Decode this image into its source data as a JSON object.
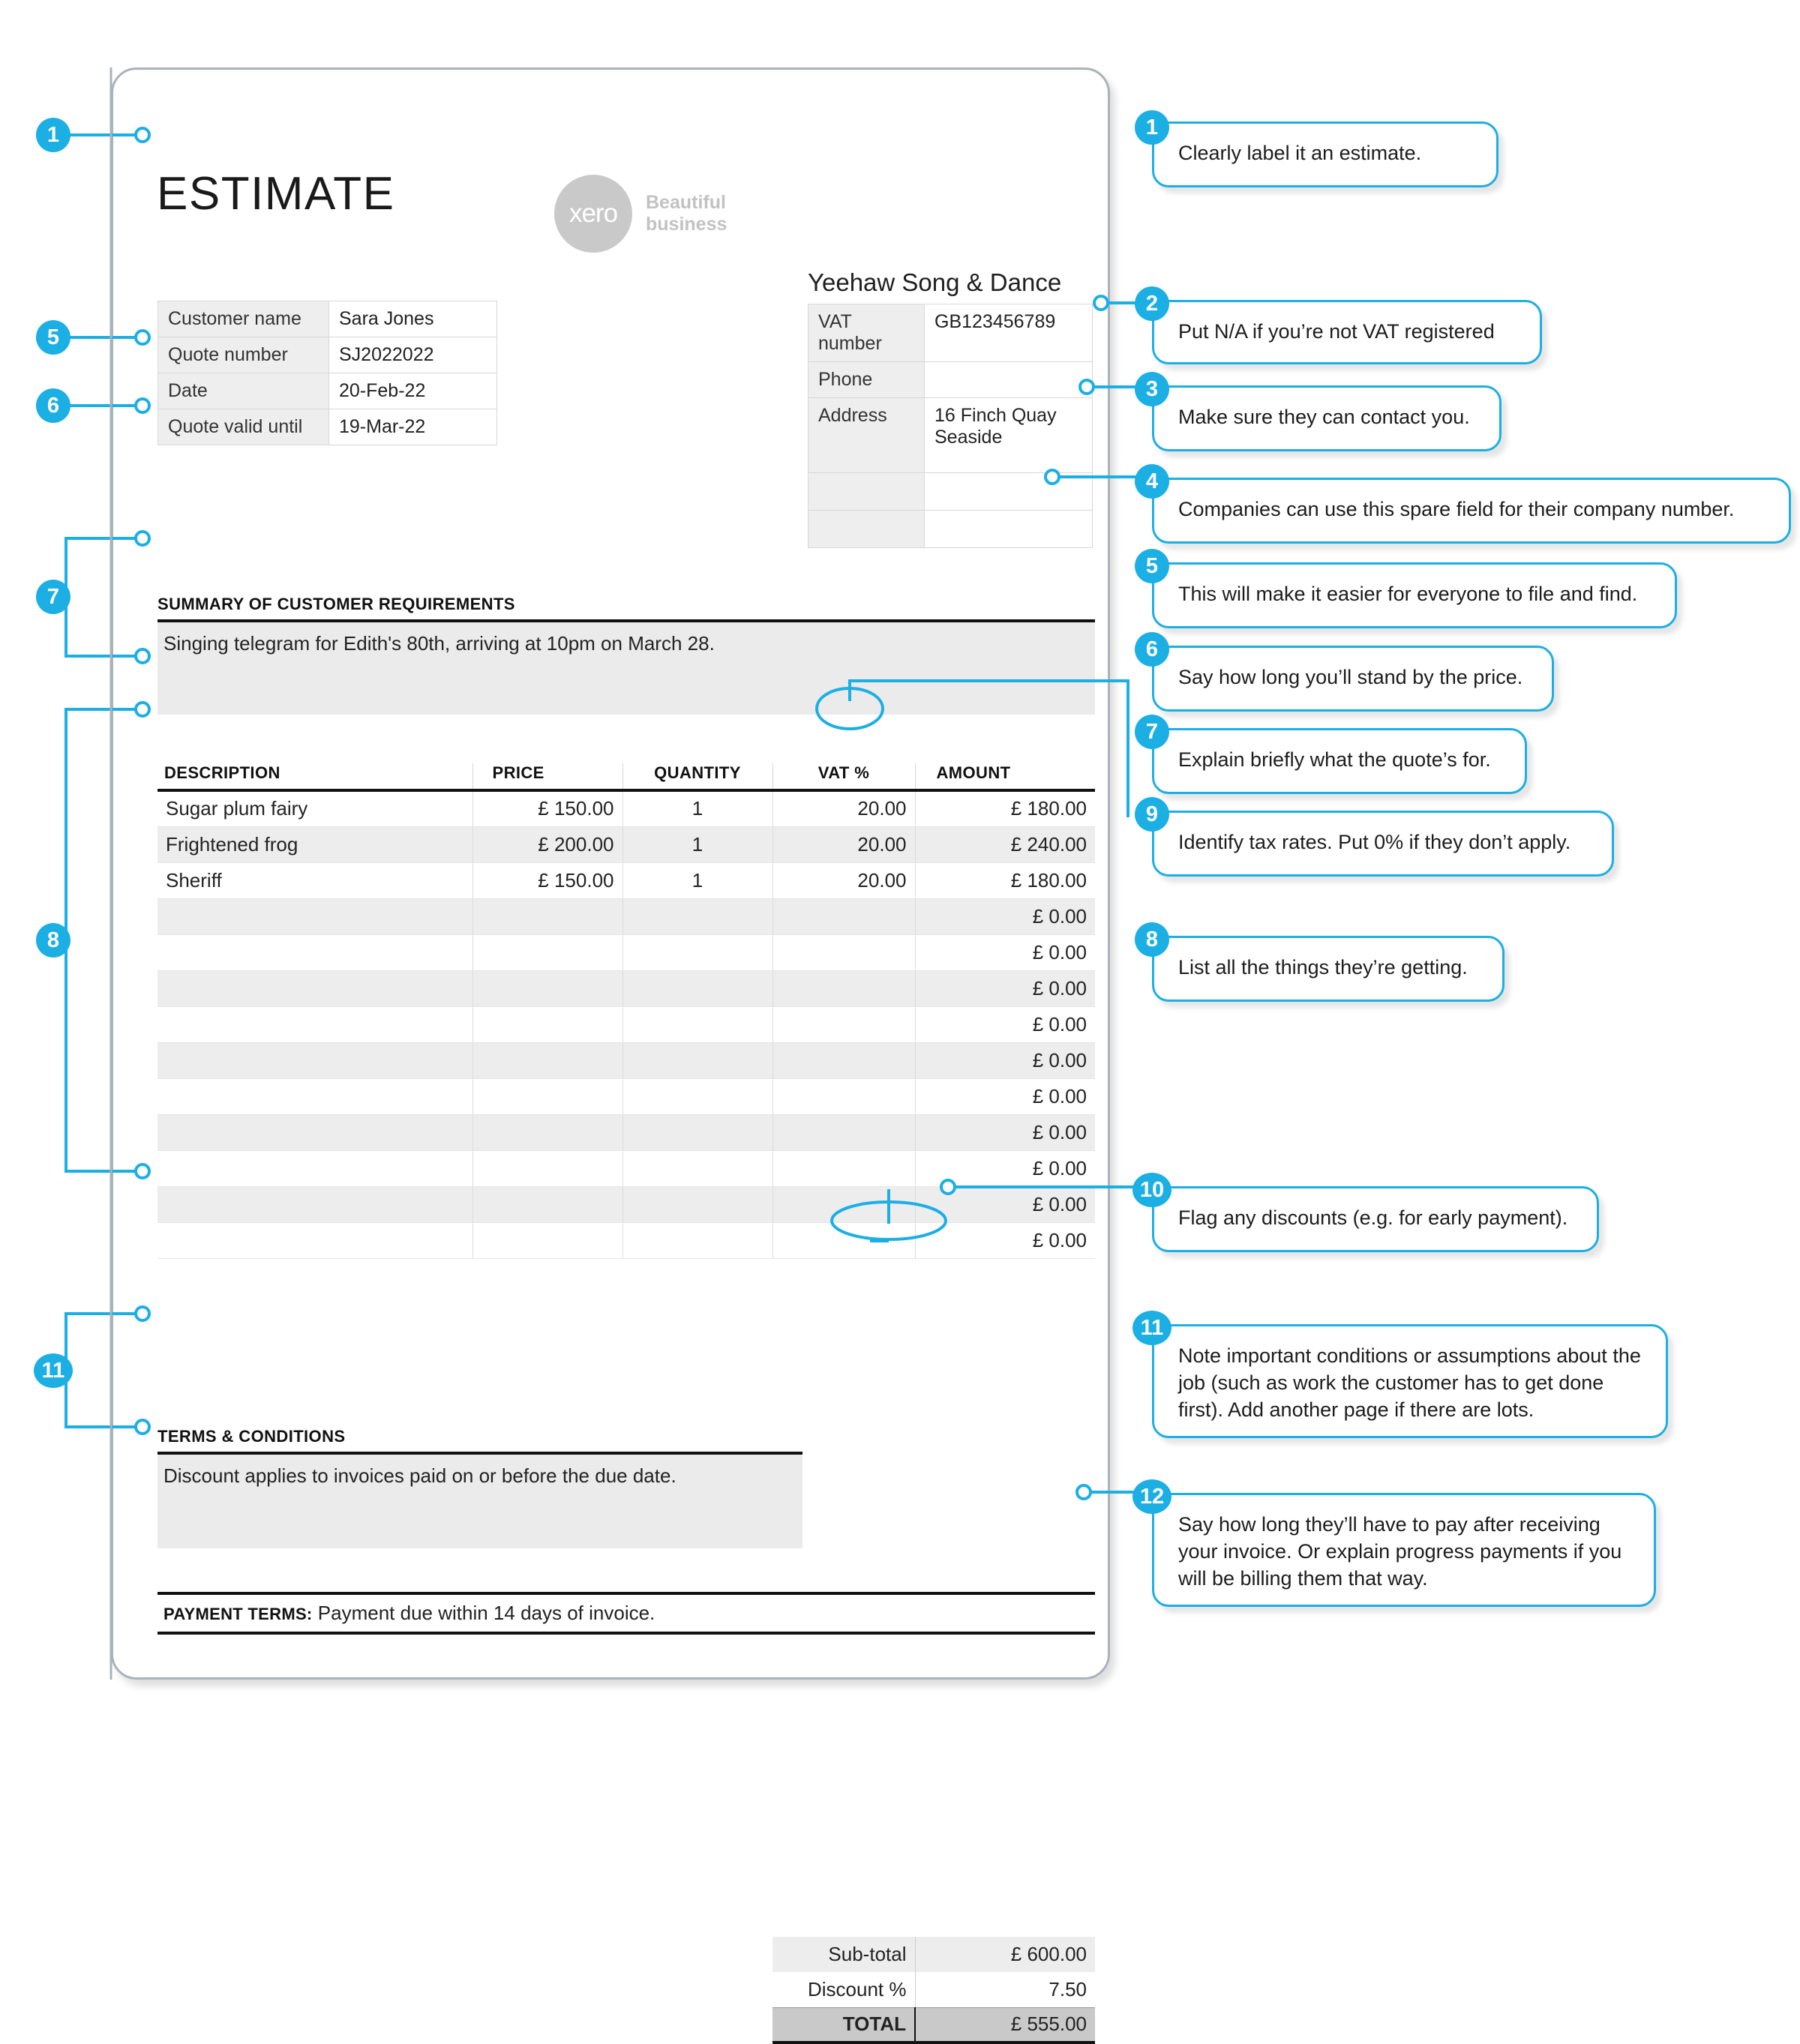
{
  "document": {
    "title": "ESTIMATE",
    "logo": {
      "wordmark": "xero",
      "tagline_line1": "Beautiful",
      "tagline_line2": "business"
    },
    "customer_fields": [
      {
        "label": "Customer name",
        "value": "Sara Jones"
      },
      {
        "label": "Quote number",
        "value": "SJ2022022"
      },
      {
        "label": "Date",
        "value": "20-Feb-22"
      },
      {
        "label": "Quote valid until",
        "value": "19-Mar-22"
      }
    ],
    "company": {
      "name": "Yeehaw Song & Dance",
      "fields": [
        {
          "label": "VAT number",
          "value": "GB123456789"
        },
        {
          "label": "Phone",
          "value": ""
        },
        {
          "label": "Address",
          "value": "16 Finch Quay\nSeaside"
        },
        {
          "label": "",
          "value": ""
        },
        {
          "label": "",
          "value": ""
        }
      ]
    },
    "summary": {
      "heading": "SUMMARY OF CUSTOMER REQUIREMENTS",
      "text": "Singing telegram for Edith's 80th, arriving at 10pm on March 28."
    },
    "items": {
      "columns": [
        "DESCRIPTION",
        "PRICE",
        "QUANTITY",
        "VAT %",
        "AMOUNT"
      ],
      "rows": [
        {
          "description": "Sugar plum fairy",
          "price": "£ 150.00",
          "quantity": "1",
          "vat": "20.00",
          "amount": "£ 180.00"
        },
        {
          "description": "Frightened frog",
          "price": "£ 200.00",
          "quantity": "1",
          "vat": "20.00",
          "amount": "£ 240.00"
        },
        {
          "description": "Sheriff",
          "price": "£ 150.00",
          "quantity": "1",
          "vat": "20.00",
          "amount": "£ 180.00"
        },
        {
          "description": "",
          "price": "",
          "quantity": "",
          "vat": "",
          "amount": "£ 0.00"
        },
        {
          "description": "",
          "price": "",
          "quantity": "",
          "vat": "",
          "amount": "£ 0.00"
        },
        {
          "description": "",
          "price": "",
          "quantity": "",
          "vat": "",
          "amount": "£ 0.00"
        },
        {
          "description": "",
          "price": "",
          "quantity": "",
          "vat": "",
          "amount": "£ 0.00"
        },
        {
          "description": "",
          "price": "",
          "quantity": "",
          "vat": "",
          "amount": "£ 0.00"
        },
        {
          "description": "",
          "price": "",
          "quantity": "",
          "vat": "",
          "amount": "£ 0.00"
        },
        {
          "description": "",
          "price": "",
          "quantity": "",
          "vat": "",
          "amount": "£ 0.00"
        },
        {
          "description": "",
          "price": "",
          "quantity": "",
          "vat": "",
          "amount": "£ 0.00"
        },
        {
          "description": "",
          "price": "",
          "quantity": "",
          "vat": "",
          "amount": "£ 0.00"
        },
        {
          "description": "",
          "price": "",
          "quantity": "",
          "vat": "",
          "amount": "£ 0.00"
        }
      ]
    },
    "totals": [
      {
        "label": "Sub-total",
        "value": "£ 600.00"
      },
      {
        "label": "Discount %",
        "value": "7.50"
      },
      {
        "label": "TOTAL",
        "value": "£ 555.00"
      }
    ],
    "terms": {
      "heading": "TERMS & CONDITIONS",
      "text": "Discount applies to invoices paid on or before the due date."
    },
    "payment_terms": {
      "label": "PAYMENT TERMS:",
      "text": "Payment due within 14 days of invoice."
    }
  },
  "annotations": {
    "accent_color": "#1bafe4",
    "left_markers": [
      {
        "number": "1"
      },
      {
        "number": "5"
      },
      {
        "number": "6"
      },
      {
        "number": "7"
      },
      {
        "number": "8"
      },
      {
        "number": "11"
      }
    ],
    "callouts": [
      {
        "number": "1",
        "text": "Clearly label it an estimate."
      },
      {
        "number": "2",
        "text": "Put N/A if you’re not VAT registered"
      },
      {
        "number": "3",
        "text": "Make sure they can contact you."
      },
      {
        "number": "4",
        "text": "Companies can use this spare field for their company number."
      },
      {
        "number": "5",
        "text": "This will make it easier for everyone to file and find."
      },
      {
        "number": "6",
        "text": "Say how long you’ll stand by the price."
      },
      {
        "number": "7",
        "text": "Explain briefly what the quote’s for."
      },
      {
        "number": "9",
        "text": "Identify tax rates. Put 0% if they don’t apply."
      },
      {
        "number": "8",
        "text": "List all the things they’re getting."
      },
      {
        "number": "10",
        "text": "Flag any discounts (e.g. for early payment)."
      },
      {
        "number": "11",
        "text": "Note important conditions or assumptions about the job (such as work the customer has to get done first). Add another page if there are lots."
      },
      {
        "number": "12",
        "text": "Say how long they’ll have to pay after receiving your invoice. Or explain progress payments if you will be billing them that way."
      }
    ]
  }
}
